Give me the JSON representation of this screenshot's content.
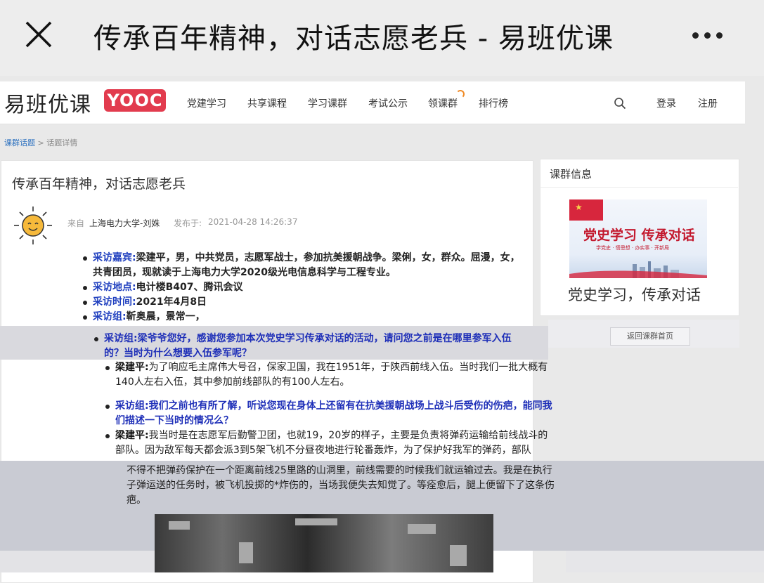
{
  "app": {
    "title": "传承百年精神，对话志愿老兵 - 易班优课",
    "close_icon": "close-icon",
    "more_icon": "more-icon"
  },
  "nav": {
    "logo_text": "易班优课",
    "logo_badge": "YOOC",
    "items": [
      "党建学习",
      "共享课程",
      "学习课群",
      "考试公示",
      "领课群",
      "排行榜"
    ],
    "login": "登录",
    "register": "注册"
  },
  "breadcrumb": {
    "items": [
      "课群话题",
      "话题详情"
    ],
    "separator": ">"
  },
  "topic": {
    "title": "传承百年精神，对话志愿老兵",
    "from_label": "来自",
    "source": "上海电力大学-刘姝",
    "published_label": "发布于:",
    "published_time": "2021-04-28 14:26:37"
  },
  "info_list": [
    {
      "label": "采访嘉宾:",
      "text": "梁建平，男，中共党员，志愿军战士，参加抗美援朝战争。梁俐，女，群众。屈漫，女，共青团员，现就读于上海电力大学2020级光电信息科学与工程专业。"
    },
    {
      "label": "采访地点:",
      "text": "电计楼B407、腾讯会议"
    },
    {
      "label": "采访时间:",
      "text": "2021年4月8日"
    },
    {
      "label": "采访组:",
      "text": "靳奥晨，景常一，"
    }
  ],
  "qa_q1": {
    "label": "采访组:",
    "text": "梁爷爷您好，感谢您参加本次党史学习传承对话的活动，请问您之前是在哪里参军入伍的？当时为什么想要入伍参军呢？"
  },
  "qa_list": [
    {
      "label": "梁建平:",
      "text": "为了响应毛主席伟大号召，保家卫国，我在1951年，于陕西前线入伍。当时我们一批大概有140人左右入伍，其中参加前线部队的有100人左右。"
    },
    {
      "label": "采访组:",
      "text": "我们之前也有所了解，听说您现在身体上还留有在抗美援朝战场上战斗后受伤的伤疤，能同我们描述一下当时的情况么？"
    },
    {
      "label": "梁建平:",
      "text": "我当时是在志愿军后勤警卫团，也就19，20岁的样子，主要是负责将弹药运输给前线战斗的部队。因为敌军每天都会派3到5架飞机不分昼夜地进行轮番轰炸，为了保护好我军的弹药，部队"
    }
  ],
  "qa_tail": "不得不把弹药保护在一个距离前线25里路的山洞里，前线需要的时候我们就运输过去。我是在执行子弹运送的任务时，被飞机投掷的*炸伤的，当场我便失去知觉了。等痊愈后，腿上便留下了这条伤疤。",
  "sidebar": {
    "heading": "课群信息",
    "banner_title": "党史学习 传承对话",
    "banner_sub": "学党史 · 悟思想 · 办实事 · 开新局",
    "caption": "党史学习，传承对话",
    "back_button": "返回课群首页"
  },
  "colors": {
    "brand_red": "#e23b4e",
    "link_blue": "#2a6fbf",
    "question_blue": "#1e2fb8"
  }
}
